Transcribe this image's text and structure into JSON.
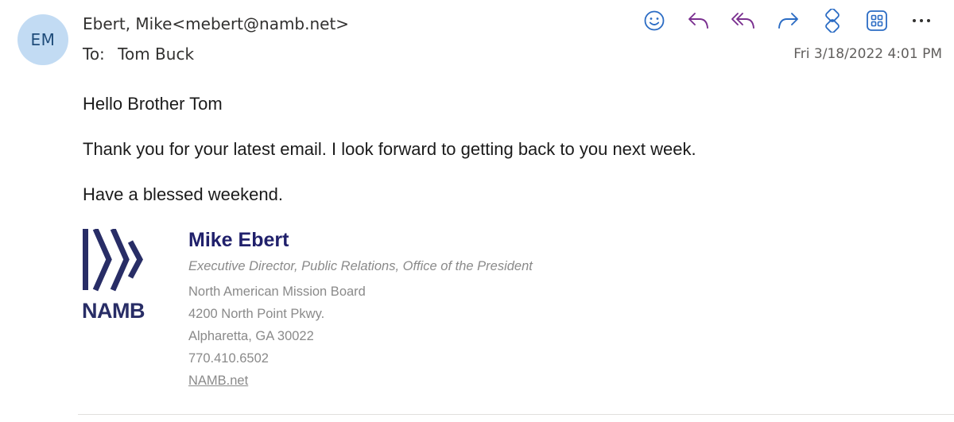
{
  "message": {
    "avatar_initials": "EM",
    "from": "Ebert, Mike<mebert@namb.net>",
    "to_label": "To:",
    "to": "Tom Buck",
    "timestamp": "Fri 3/18/2022 4:01 PM"
  },
  "toolbar": {
    "icons": [
      "emoji-icon",
      "reply-icon",
      "reply-all-icon",
      "forward-icon",
      "loop-icon",
      "apps-icon",
      "more-icon"
    ],
    "accent_color": "#2b6cc4",
    "reply_color": "#7a2f8f"
  },
  "body": {
    "greeting": "Hello Brother Tom",
    "line1": "Thank you for your latest email. I look forward to getting back to you next week.",
    "line2": "Have a blessed weekend."
  },
  "signature": {
    "logo_text": "NAMB",
    "name": "Mike Ebert",
    "title": "Executive Director, Public Relations, Office of the President",
    "org": "North American Mission Board",
    "address1": "4200 North Point Pkwy.",
    "address2": "Alpharetta, GA 30022",
    "phone": "770.410.6502",
    "link": "NAMB.net",
    "brand_color": "#282d66"
  }
}
